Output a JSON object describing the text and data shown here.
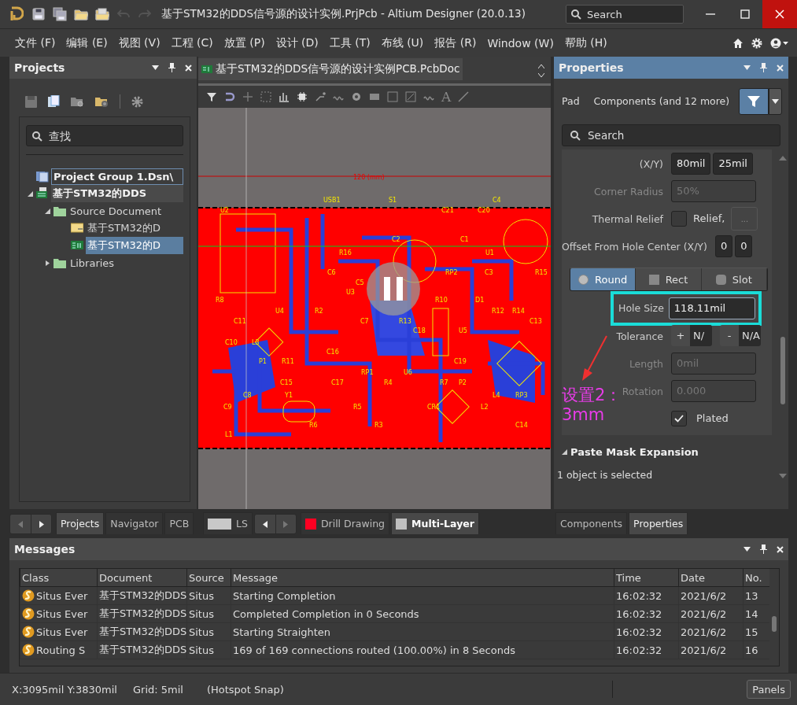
{
  "titlebar": {
    "title": "基于STM32的DDS信号源的设计实例.PrjPcb - Altium Designer (20.0.13)",
    "search_placeholder": "Search",
    "tools": [
      {
        "kind": "save",
        "disabled": false
      },
      {
        "kind": "save-all",
        "disabled": false
      },
      {
        "kind": "open",
        "disabled": false
      },
      {
        "kind": "open-project",
        "disabled": false
      },
      {
        "kind": "undo",
        "disabled": true
      },
      {
        "kind": "redo",
        "disabled": true
      }
    ]
  },
  "menu": [
    "文件 (F)",
    "编辑 (E)",
    "视图 (V)",
    "工程 (C)",
    "放置 (P)",
    "设计 (D)",
    "工具 (T)",
    "布线 (U)",
    "报告 (R)",
    "Window (W)",
    "帮助 (H)"
  ],
  "projects_panel": {
    "title": "Projects",
    "search_placeholder": "查找",
    "tree": [
      {
        "label": "Project Group 1.Dsn\\",
        "kind": "group",
        "selected": false
      },
      {
        "label": "基于STM32的DDS",
        "kind": "project",
        "selected": false,
        "expanded": true,
        "children": [
          {
            "label": "Source Document",
            "kind": "folder",
            "selected": false,
            "expanded": true,
            "children": [
              {
                "label": "基于STM32的D",
                "kind": "schematic",
                "selected": false
              },
              {
                "label": "基于STM32的D",
                "kind": "pcb",
                "selected": true
              }
            ]
          },
          {
            "label": "Libraries",
            "kind": "folder",
            "selected": false,
            "expanded": false
          }
        ]
      }
    ]
  },
  "document": {
    "tab": "基于STM32的DDS信号源的设计实例PCB.PcbDoc",
    "toolbar": [
      {
        "kind": "filter"
      },
      {
        "kind": "magnet"
      },
      {
        "kind": "plus"
      },
      {
        "kind": "select"
      },
      {
        "kind": "bars"
      },
      {
        "kind": "chip"
      },
      {
        "kind": "route"
      },
      {
        "kind": "wave"
      },
      {
        "kind": "via"
      },
      {
        "kind": "rect"
      },
      {
        "kind": "square"
      },
      {
        "kind": "graph"
      },
      {
        "kind": "wave"
      },
      {
        "kind": "text",
        "label": "A"
      },
      {
        "kind": "line"
      }
    ],
    "dimension": "120 (mm)",
    "paused": true,
    "designators": [
      "USB1",
      "S1",
      "C4",
      "U2",
      "C21",
      "C20",
      "C2",
      "C1",
      "R16",
      "U1",
      "C6",
      "RP2",
      "C3",
      "R15",
      "C5",
      "U3",
      "R8",
      "R10",
      "D1",
      "U4",
      "R2",
      "R12",
      "R14",
      "C11",
      "C7",
      "R13",
      "C13",
      "C18",
      "U5",
      "C10",
      "L3",
      "C16",
      "P1",
      "R11",
      "C19",
      "RP1",
      "U6",
      "C15",
      "C17",
      "R4",
      "R7",
      "P2",
      "C8",
      "Y1",
      "L4",
      "RP3",
      "C9",
      "R5",
      "CR1",
      "L2",
      "R6",
      "R3",
      "C14",
      "L1"
    ]
  },
  "properties": {
    "title": "Properties",
    "object": "Pad",
    "filter": "Components (and 12 more)",
    "search_placeholder": "Search",
    "rows": [
      {
        "kind": "pair",
        "label": "(X/Y)",
        "values": [
          "80mil",
          "25mil"
        ],
        "disabled": false
      },
      {
        "kind": "field",
        "label": "Corner Radius",
        "value": "50%",
        "disabled": true
      },
      {
        "kind": "thermal",
        "label": "Thermal Relief",
        "checked": false,
        "text": "Relief,",
        "button": "..."
      },
      {
        "kind": "pair",
        "label": "Offset From Hole Center (X/Y)",
        "values": [
          "0",
          "0"
        ],
        "disabled": false
      },
      {
        "kind": "shapes",
        "options": [
          {
            "label": "Round",
            "selected": true
          },
          {
            "label": "Rect",
            "selected": false
          },
          {
            "label": "Slot",
            "selected": false
          }
        ]
      },
      {
        "kind": "field",
        "label": "Hole Size",
        "value": "118.11mil",
        "disabled": false,
        "highlighted": true
      },
      {
        "kind": "tolerance",
        "label": "Tolerance",
        "plus": "+",
        "plus_value": "N/",
        "minus": "-",
        "minus_value": "N/A"
      },
      {
        "kind": "field",
        "label": "Length",
        "value": "0mil",
        "disabled": true
      },
      {
        "kind": "field",
        "label": "Rotation",
        "value": "0.000",
        "disabled": true
      },
      {
        "kind": "check",
        "label": "Plated",
        "checked": true
      }
    ],
    "section": {
      "title": "Paste Mask Expansion",
      "expanded": true
    },
    "annotation": {
      "lines": [
        "设置2：",
        "3mm"
      ]
    },
    "status": "1 object is selected",
    "tabs": [
      {
        "label": "Components",
        "selected": false
      },
      {
        "label": "Properties",
        "selected": true
      }
    ]
  },
  "panel_tabs": [
    {
      "label": "Projects",
      "selected": true
    },
    {
      "label": "Navigator",
      "selected": false
    },
    {
      "label": "PCB",
      "selected": false
    }
  ],
  "layer_tabs": [
    {
      "label": "LS",
      "color": "#c8c8c8",
      "selected": false
    },
    {
      "label": "Drill Drawing",
      "color": "#ff0022",
      "selected": false
    },
    {
      "label": "Multi-Layer",
      "color": "#c0c0c0",
      "selected": true
    }
  ],
  "messages": {
    "title": "Messages",
    "columns": [
      "Class",
      "Document",
      "Source",
      "Message",
      "Time",
      "Date",
      "No."
    ],
    "rows": [
      [
        "Situs Ever",
        "基于STM32的DDS",
        "Situs",
        "Starting Completion",
        "16:02:32",
        "2021/6/2",
        "13"
      ],
      [
        "Situs Ever",
        "基于STM32的DDS",
        "Situs",
        "Completed Completion in 0 Seconds",
        "16:02:32",
        "2021/6/2",
        "14"
      ],
      [
        "Situs Ever",
        "基于STM32的DDS",
        "Situs",
        "Starting Straighten",
        "16:02:32",
        "2021/6/2",
        "15"
      ],
      [
        "Routing S",
        "基于STM32的DDS",
        "Situs",
        "169 of 169 connections routed (100.00%) in 8 Seconds",
        "16:02:32",
        "2021/6/2",
        "16"
      ]
    ]
  },
  "status_bar": {
    "coordinates": "X:3095mil Y:3830mil",
    "grid": "Grid: 5mil",
    "snap": "(Hotspot Snap)",
    "button": "Panels"
  }
}
